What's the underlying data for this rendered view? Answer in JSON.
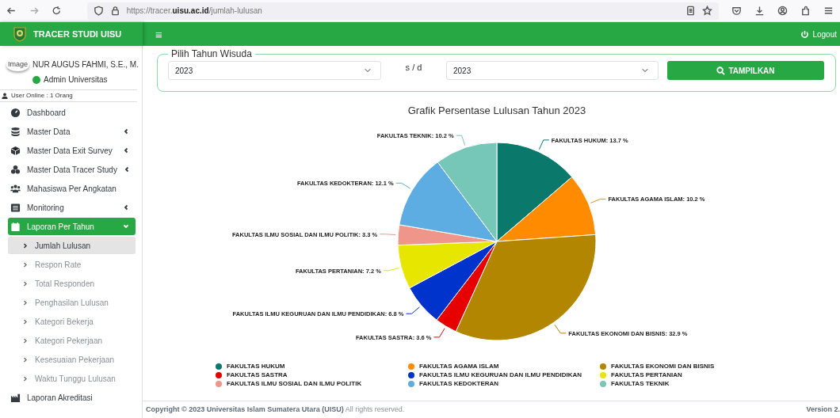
{
  "browser": {
    "url": "https://tracer.**uisu.ac.id**/jumlah-lulusan"
  },
  "brand": {
    "title": "TRACER STUDI UISU"
  },
  "navbar": {
    "menu_glyph": "≡",
    "logout": "Logout"
  },
  "user": {
    "image_alt": "Image",
    "name": "NUR AUGUS FAHMI, S.E., M.",
    "role": "Admin Universitas",
    "online": "User Online : 1 Orang"
  },
  "sidebar": {
    "items": [
      {
        "label": "Dashboard",
        "selected": false
      },
      {
        "label": "Master Data",
        "expanded": false,
        "selected": false
      },
      {
        "label": "Master Data Exit Survey",
        "expanded": false,
        "selected": false
      },
      {
        "label": "Master Data Tracer Study",
        "expanded": false,
        "selected": false
      },
      {
        "label": "Mahasiswa Per Angkatan",
        "selected": false
      },
      {
        "label": "Monitoring",
        "expanded": false,
        "selected": false
      },
      {
        "label": "Laporan Per Tahun",
        "expanded": true,
        "selected": true,
        "children": [
          {
            "label": "Jumlah Lulusan",
            "selected": true
          },
          {
            "label": "Respon Rate",
            "selected": false
          },
          {
            "label": "Total Responden",
            "selected": false
          },
          {
            "label": "Penghasilan Lulusan",
            "selected": false
          },
          {
            "label": "Kategori Bekerja",
            "selected": false
          },
          {
            "label": "Kategori Pekerjaan",
            "selected": false
          },
          {
            "label": "Kesesuaian Pekerjaan",
            "selected": false
          },
          {
            "label": "Waktu Tunggu Lulusan",
            "selected": false
          }
        ]
      },
      {
        "label": "Laporan Akreditasi",
        "selected": false
      }
    ]
  },
  "filter": {
    "legend": "Pilih Tahun Wisuda",
    "from": "2023",
    "separator": "s / d",
    "to": "2023",
    "button": "TAMPILKAN"
  },
  "report": {
    "chart_data": {
      "type": "pie",
      "title": "Grafik Persentase Lulusan Tahun 2023",
      "categories": [
        "FAKULTAS HUKUM",
        "FAKULTAS AGAMA ISLAM",
        "FAKULTAS EKONOMI DAN BISNIS",
        "FAKULTAS SASTRA",
        "FAKULTAS ILMU KEGURUAN DAN ILMU PENDIDIKAN",
        "FAKULTAS PERTANIAN",
        "FAKULTAS ILMU SOSIAL DAN ILMU POLITIK",
        "FAKULTAS KEDOKTERAN",
        "FAKULTAS TEKNIK"
      ],
      "series": [
        {
          "values": [
            13.7,
            10.2,
            32.9,
            3.6,
            6.8,
            7.2,
            3.3,
            12.1,
            10.2
          ]
        }
      ],
      "colors": [
        "#0b786c",
        "#ff8c00",
        "#b38600",
        "#e60000",
        "#0033cc",
        "#e6e600",
        "#f0958a",
        "#5dade2",
        "#76c7b7"
      ],
      "value_labels": [
        "FAKULTAS HUKUM: 13.7 %",
        "FAKULTAS AGAMA ISLAM: 10.2 %",
        "FAKULTAS EKONOMI DAN BISNIS: 32.9 %",
        "FAKULTAS SASTRA: 3.6 %",
        "FAKULTAS ILMU KEGURUAN DAN ILMU PENDIDIKAN: 6.8 %",
        "FAKULTAS PERTANIAN: 7.2 %",
        "FAKULTAS ILMU SOSIAL DAN ILMU POLITIK: 3.3 %",
        "FAKULTAS KEDOKTERAN: 12.1 %",
        "FAKULTAS TEKNIK: 10.2 %"
      ]
    }
  },
  "footer": {
    "copyright": "**Copyright © 2023 Universitas Islam Sumatera Utara (UISU)** All rights reserved.",
    "version": "Version 2."
  }
}
